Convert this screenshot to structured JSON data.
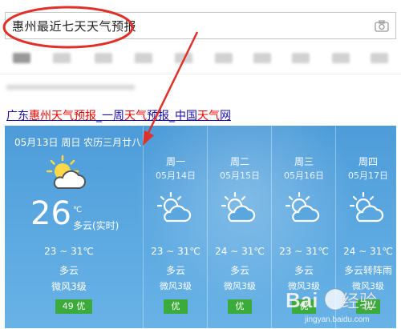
{
  "search": {
    "query": "惠州最近七天天气预报"
  },
  "result": {
    "link_prefix": "广东",
    "link_hl1": "惠州天气预报",
    "link_mid": "_一周",
    "link_hl2": "天气",
    "link_mid2": "预报_中国",
    "link_hl3": "天气",
    "link_suffix": "网"
  },
  "weather": {
    "today": {
      "date_line": "05月13日 周日 农历三月廿八",
      "temp": "26",
      "unit": "℃",
      "condition": "多云(实时)",
      "range": "23 ~ 31℃",
      "desc": "多云",
      "wind": "微风3级",
      "aqi": "49 优",
      "icon": "partly-cloudy-sun-icon"
    },
    "days": [
      {
        "weekday": "周一",
        "date": "05月14日",
        "range": "23 ~ 31℃",
        "desc": "多云",
        "wind": "微风3级",
        "aqi": "优",
        "icon": "partly-cloudy-sun-icon"
      },
      {
        "weekday": "周二",
        "date": "05月15日",
        "range": "24 ~ 31℃",
        "desc": "多云",
        "wind": "微风3级",
        "aqi": "优",
        "icon": "partly-cloudy-sun-icon"
      },
      {
        "weekday": "周三",
        "date": "05月16日",
        "range": "23 ~ 31℃",
        "desc": "多云",
        "wind": "微风3级",
        "aqi": "优",
        "icon": "partly-cloudy-sun-icon"
      },
      {
        "weekday": "周四",
        "date": "05月17日",
        "range": "24 ~ 31℃",
        "desc": "多云转阵雨",
        "wind": "微风3级",
        "aqi": "优",
        "icon": "partly-cloudy-sun-icon"
      }
    ]
  },
  "colors": {
    "annotation": "#e0302a",
    "aqi_good": "#3bab3b",
    "link": "#1a0dab",
    "highlight": "#e10602"
  },
  "watermark": {
    "text": "Bai百经验",
    "url": "jingyan.baidu.com"
  }
}
